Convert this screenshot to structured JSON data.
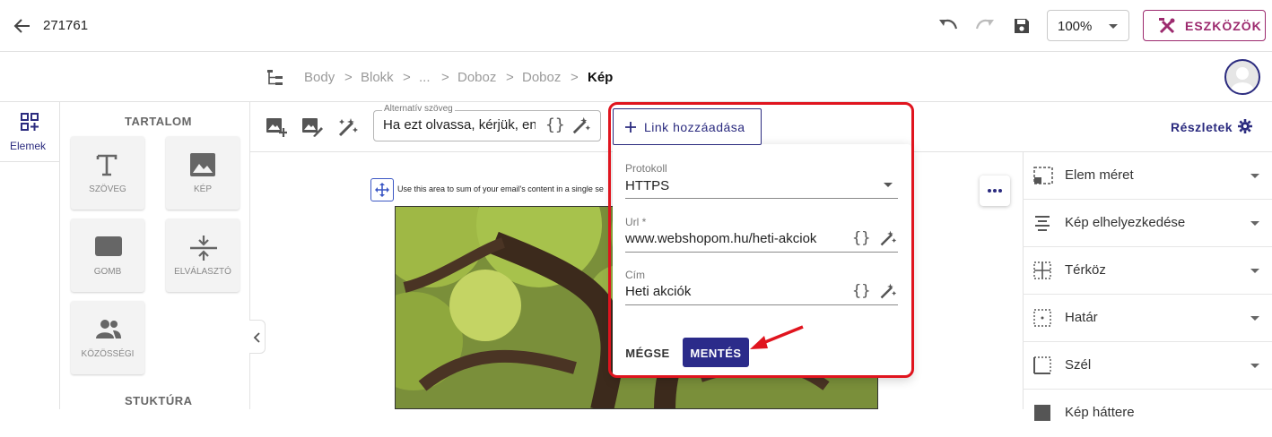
{
  "header": {
    "doc_id": "271761",
    "zoom": "100%",
    "tools_label": "ESZKÖZÖK"
  },
  "breadcrumb": [
    "Body",
    "Blokk",
    "...",
    "Doboz",
    "Doboz",
    "Kép"
  ],
  "left_rail": {
    "elements_label": "Elemek"
  },
  "elements_panel": {
    "content_title": "TARTALOM",
    "structure_title": "STUKTÚRA",
    "tiles": [
      "SZÖVEG",
      "KÉP",
      "GOMB",
      "ELVÁLASZTÓ",
      "KÖZÖSSÉGI"
    ]
  },
  "toolbar": {
    "alt_legend": "Alternatív szöveg",
    "alt_value": "Ha ezt olvassa, kérjük, eng",
    "details_label": "Részletek"
  },
  "canvas": {
    "preheader": "Use this area to sum of your email's content in a single se"
  },
  "popup": {
    "link_add_label": "Link hozzáadása",
    "protocol_label": "Protokoll",
    "protocol_value": "HTTPS",
    "url_label": "Url *",
    "url_value": "www.webshopom.hu/heti-akciok",
    "title_label": "Cím",
    "title_value": "Heti akciók",
    "cancel_label": "MÉGSE",
    "save_label": "MENTÉS",
    "braces": "{}"
  },
  "right_panel": {
    "props": [
      "Elem méret",
      "Kép elhelyezkedése",
      "Térköz",
      "Határ",
      "Szél",
      "Kép háttere"
    ]
  },
  "colors": {
    "accent": "#2b2b8a",
    "tools": "#9c2a6e",
    "highlight": "#e0141e"
  }
}
